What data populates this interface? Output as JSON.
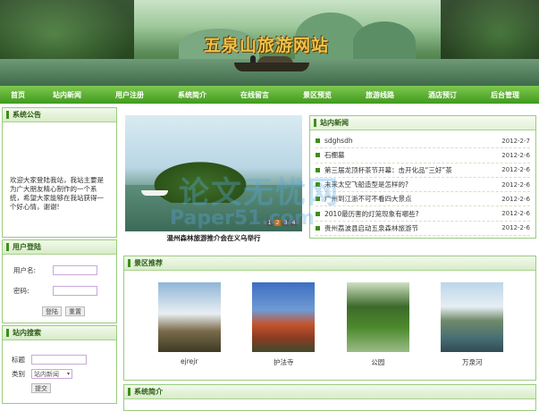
{
  "site": {
    "title": "五泉山旅游网站"
  },
  "nav": [
    "首页",
    "站内新闻",
    "用户注册",
    "系统简介",
    "在线留言",
    "景区预览",
    "旅游线路",
    "酒店预订",
    "后台管理"
  ],
  "notice": {
    "heading": "系统公告",
    "text": "欢迎大家登陆我站，我站主要是为广大朋友精心制作的一个系统，希望大家能够在我站获得一个好心情，谢谢!"
  },
  "login": {
    "heading": "用户登陆",
    "user_label": "用户名:",
    "pass_label": "密码:",
    "login_btn": "登陆",
    "reset_btn": "重置"
  },
  "search": {
    "heading": "站内搜索",
    "title_label": "标题",
    "type_label": "类别",
    "type_value": "站内新闻",
    "submit_btn": "提交"
  },
  "slideshow": {
    "caption": "温州森林旅游推介会在义乌举行",
    "dots": [
      "1",
      "2",
      "3",
      "4"
    ],
    "active": 1
  },
  "news": {
    "heading": "站内新闻",
    "items": [
      {
        "title": "sdghsdh",
        "date": "2012-2-7"
      },
      {
        "title": "石棚墓",
        "date": "2012-2-6"
      },
      {
        "title": "第三届龙顶杯茶节开幕：击开化品“三好”茶",
        "date": "2012-2-6"
      },
      {
        "title": "未来太空飞船造型是怎样的?",
        "date": "2012-2-6"
      },
      {
        "title": "广州到江浙不可不看四大景点",
        "date": "2012-2-6"
      },
      {
        "title": "2010最历害的灯笼现象有哪些?",
        "date": "2012-2-6"
      },
      {
        "title": "贵州荔波县启动五泉森林旅游节",
        "date": "2012-2-6"
      }
    ]
  },
  "recommended": {
    "heading": "景区推荐",
    "items": [
      {
        "caption": "ejrejr"
      },
      {
        "caption": "护法寺"
      },
      {
        "caption": "公园"
      },
      {
        "caption": "万泉河"
      }
    ]
  },
  "intro": {
    "heading": "系统简介"
  },
  "watermark": {
    "line1": "论文无忧网",
    "line2": "Paper51.com"
  }
}
